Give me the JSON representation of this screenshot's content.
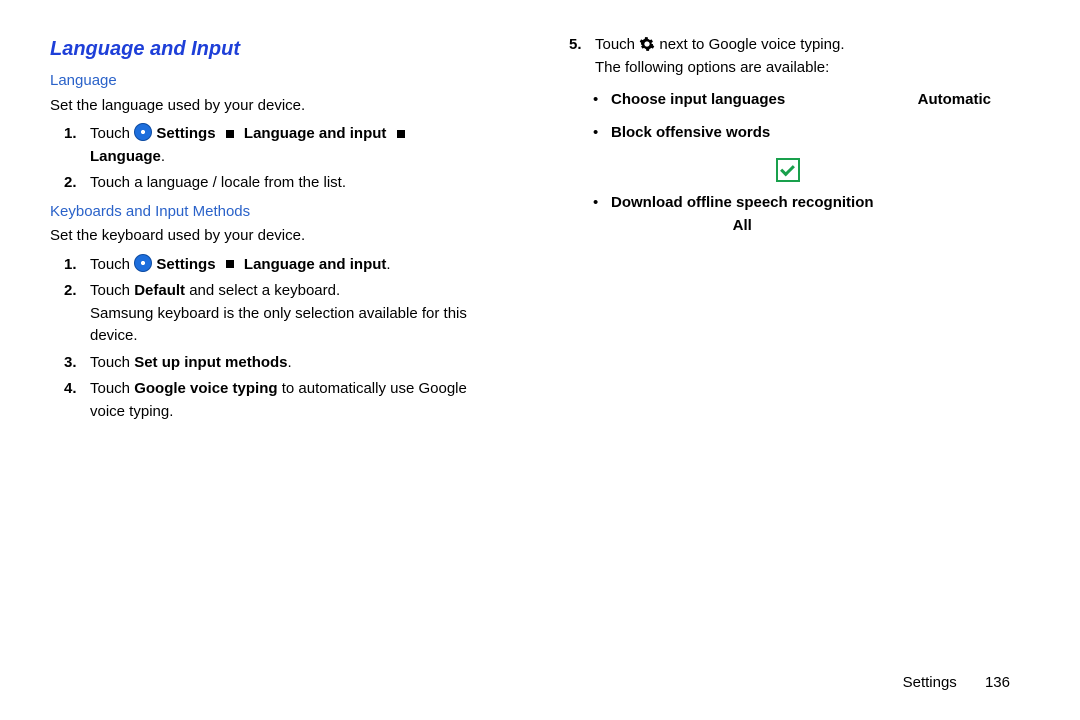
{
  "left": {
    "heading": "Language and Input",
    "sub1": "Language",
    "lang_desc": "Set the language used by your device.",
    "s1": {
      "num": "1.",
      "touch": "Touch ",
      "settings": "Settings",
      "li": "Language and input",
      "lang": "Language",
      "dot": "."
    },
    "s2": {
      "num": "2.",
      "text": "Touch a language / locale from the list."
    },
    "sub2": "Keyboards and Input Methods",
    "kb_desc": "Set the keyboard used by your device.",
    "k1": {
      "num": "1.",
      "touch": "Touch ",
      "settings": "Settings",
      "li": "Language and input",
      "dot": "."
    },
    "k2": {
      "num": "2.",
      "a": "Touch ",
      "b": "Default",
      "c": " and select a keyboard.",
      "note": "Samsung keyboard is the only selection available for this device."
    },
    "k3": {
      "num": "3.",
      "a": "Touch ",
      "b": "Set up input methods",
      "c": "."
    },
    "k4": {
      "num": "4.",
      "a": "Touch ",
      "b": "Google voice typing",
      "c": " to automatically use Google voice typing."
    }
  },
  "right": {
    "s5": {
      "num": "5.",
      "a": "Touch ",
      "b": " next to Google voice typing.",
      "c": "The following options are available:"
    },
    "opt1": {
      "label": "Choose input languages",
      "value": "Automatic"
    },
    "opt2": {
      "label": "Block offensive words"
    },
    "opt3": {
      "label": "Download offline speech recognition",
      "sub": "All"
    }
  },
  "footer": {
    "section": "Settings",
    "page": "136"
  }
}
